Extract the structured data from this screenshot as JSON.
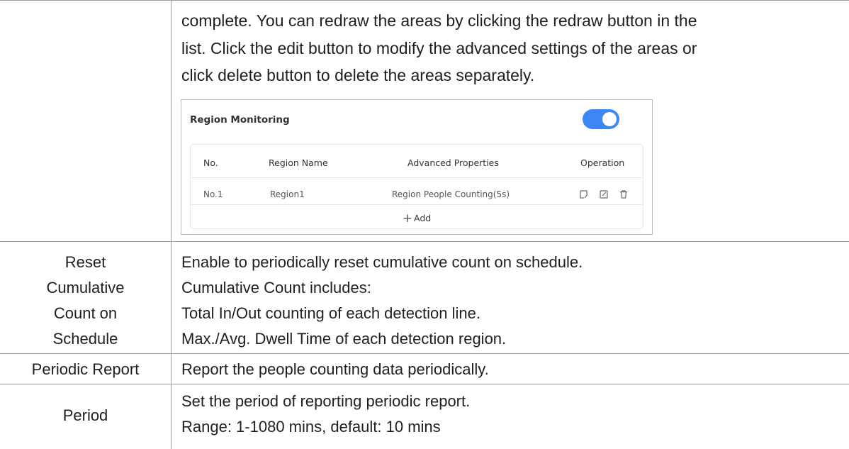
{
  "intro_lines": [
    "complete. You can redraw the areas by clicking the redraw button in the",
    "list. Click the edit button to modify the advanced settings of the areas or",
    "click delete button to delete the areas separately."
  ],
  "region_panel": {
    "title": "Region Monitoring",
    "toggle_on": true,
    "accent_color": "#3e86f5",
    "columns": [
      "No.",
      "Region Name",
      "Advanced Properties",
      "Operation"
    ],
    "rows": [
      {
        "no": "No.1",
        "name": "Region1",
        "properties": "Region People Counting(5s)",
        "operations": [
          "redraw-icon",
          "edit-icon",
          "delete-icon"
        ]
      }
    ],
    "add_label": "Add"
  },
  "rows": [
    {
      "label_lines": [
        "Reset",
        "Cumulative",
        "Count on",
        "Schedule"
      ],
      "desc_lines": [
        "Enable to periodically reset cumulative count on schedule.",
        "Cumulative Count includes:",
        "Total In/Out counting of each detection line.",
        "Max./Avg. Dwell Time of each detection region."
      ]
    },
    {
      "label_lines": [
        "Periodic Report"
      ],
      "desc_lines": [
        "Report the people counting data periodically."
      ]
    },
    {
      "label_lines": [
        "Period"
      ],
      "desc_lines": [
        "Set the period of reporting periodic report.",
        "Range: 1-1080 mins, default: 10 mins"
      ]
    }
  ]
}
